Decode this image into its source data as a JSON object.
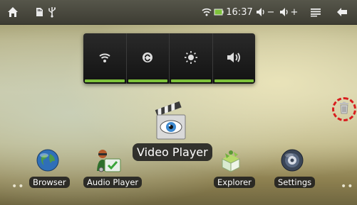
{
  "status_bar": {
    "home_icon": "home-icon",
    "sd_icon": "sd-card-icon",
    "usb_icon": "usb-icon",
    "wifi_icon": "wifi-icon",
    "battery_icon": "battery-icon",
    "time": "16:37",
    "volume_down": "−",
    "volume_up": "+",
    "menu_icon": "menu-icon",
    "back_icon": "back-icon"
  },
  "quick_settings": [
    {
      "name": "wifi-toggle",
      "icon": "wifi-icon"
    },
    {
      "name": "auto-rotate-toggle",
      "icon": "rotate-icon"
    },
    {
      "name": "brightness-toggle",
      "icon": "brightness-icon"
    },
    {
      "name": "sound-toggle",
      "icon": "speaker-icon"
    }
  ],
  "center_app": {
    "label": "Video Player",
    "icon": "clapperboard-eye-icon"
  },
  "dock": [
    {
      "label": "Browser",
      "icon": "globe-icon"
    },
    {
      "label": "Audio Player",
      "icon": "audio-player-icon"
    },
    {
      "label": "Explorer",
      "icon": "explorer-icon"
    },
    {
      "label": "Settings",
      "icon": "settings-icon"
    }
  ],
  "trash_icon": "trash-icon",
  "accent_colors": {
    "toggle_on": "#7ec23b",
    "trash_highlight": "#d81e1e"
  }
}
